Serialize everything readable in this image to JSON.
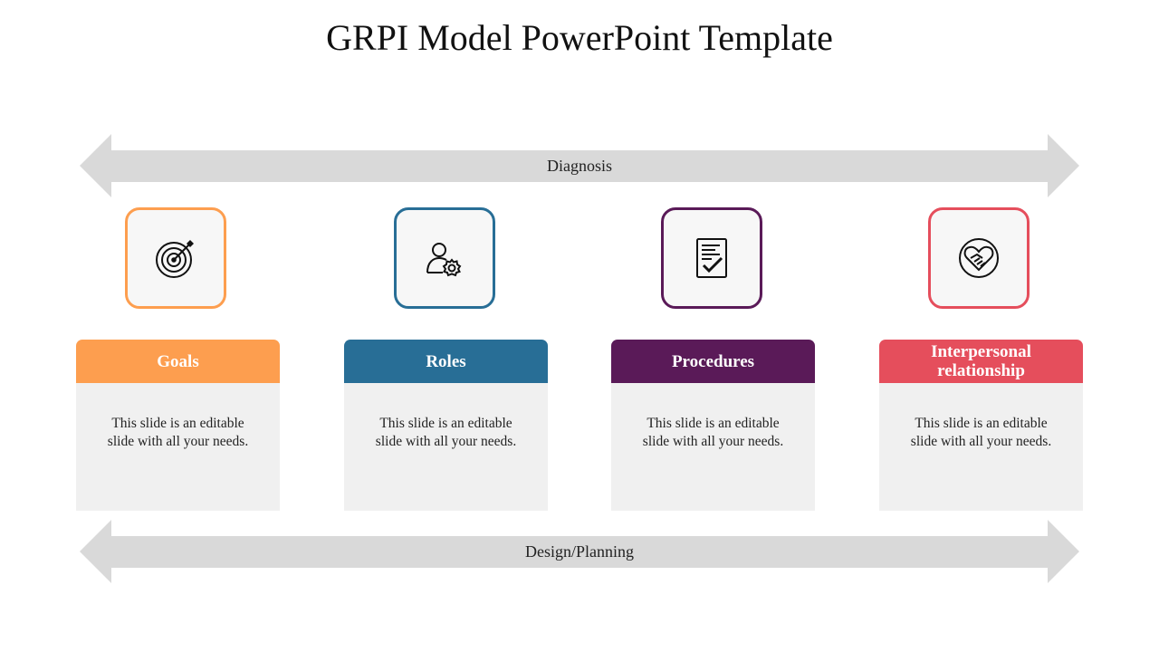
{
  "title": "GRPI Model PowerPoint Template",
  "arrows": {
    "top_label": "Diagnosis",
    "bottom_label": "Design/Planning",
    "color": "#d9d9d9"
  },
  "columns": [
    {
      "heading": "Goals",
      "body": "This slide is an editable slide with all your needs.",
      "color": "#fd9e4f",
      "icon": "target-icon"
    },
    {
      "heading": "Roles",
      "body": "This slide is an editable slide with all your needs.",
      "color": "#286e96",
      "icon": "user-settings-icon"
    },
    {
      "heading": "Procedures",
      "body": "This slide is an editable slide with all your needs.",
      "color": "#5a1a58",
      "icon": "checklist-document-icon"
    },
    {
      "heading": "Interpersonal relationship",
      "body": "This slide is an editable slide with all your needs.",
      "color": "#e54e5c",
      "icon": "handshake-heart-icon"
    }
  ]
}
